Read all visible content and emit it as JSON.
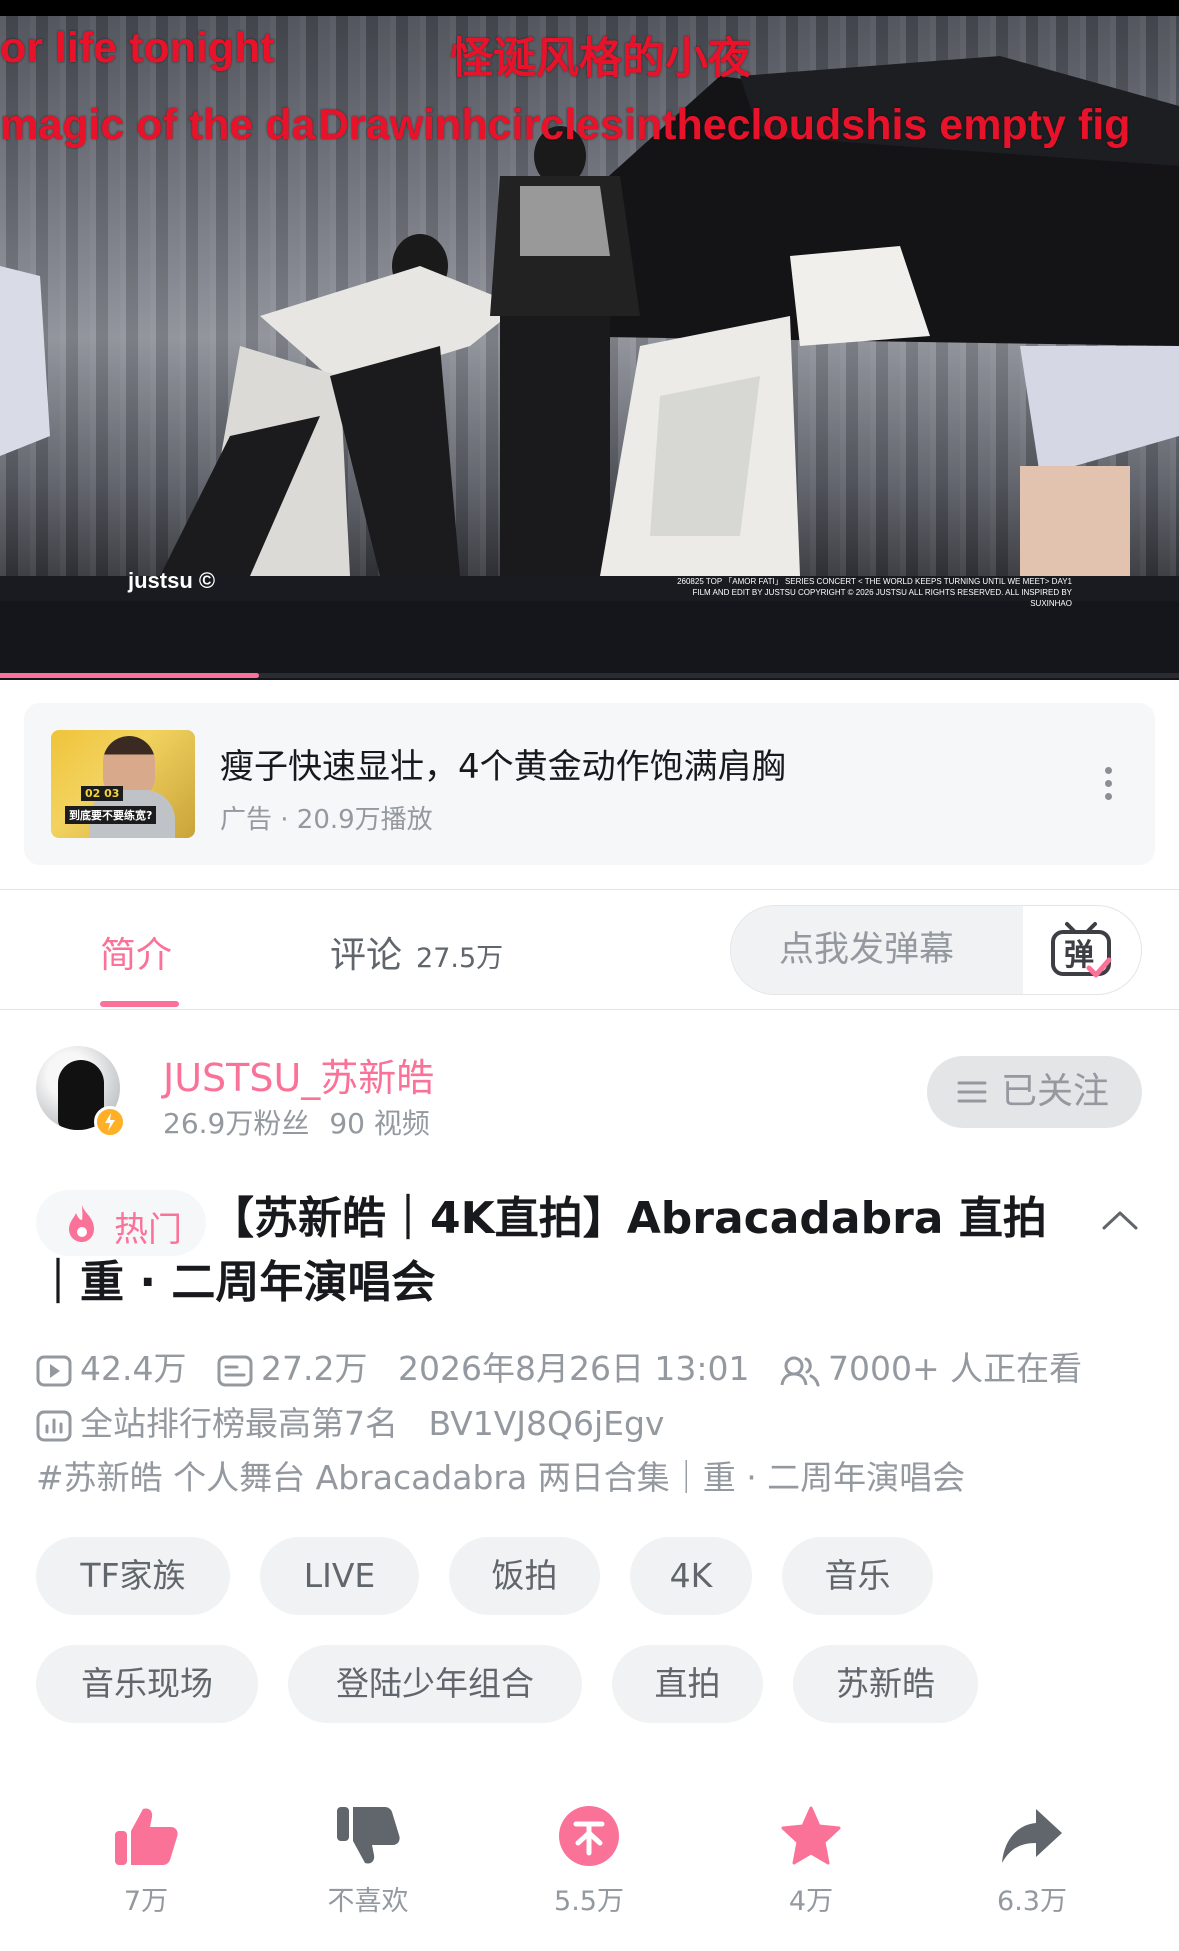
{
  "video": {
    "danmaku": [
      "or life tonight",
      "怪诞风格的小夜",
      "magic of the da",
      "Drawinhcirclesinthecloudshis empty fig"
    ],
    "watermark": "justsu ©",
    "credits": [
      "260825 TOP 「AMOR FATI」 SERIES CONCERT < THE WORLD KEEPS TURNING UNTIL WE MEET> DAY1",
      "FILM AND EDIT BY JUSTSU COPYRIGHT © 2026 JUSTSU ALL RIGHTS RESERVED. ALL INSPIRED BY SUXINHAO"
    ],
    "progress_fraction": 0.22,
    "accent_color": "#fb7299"
  },
  "ad": {
    "thumb_tag1": "02 03",
    "thumb_tag2": "到底要不要练宽?",
    "title": "瘦子快速显壮，4个黄金动作饱满肩胸",
    "subtitle": "广告 · 20.9万播放",
    "more_icon": "more-vertical-icon"
  },
  "tabs": {
    "intro": "简介",
    "comments": "评论",
    "comments_count": "27.5万",
    "danmaku_placeholder": "点我发弹幕",
    "danmaku_toggle_char": "弹"
  },
  "uploader": {
    "name": "JUSTSU_苏新皓",
    "fans": "26.9万粉丝",
    "videos": "90 视频",
    "follow_label": "已关注"
  },
  "video_info": {
    "hot_label": "热门",
    "title": "【苏新皓｜4K直拍】Abracadabra 直拍｜重 · 二周年演唱会",
    "plays": "42.4万",
    "danmaku_count": "27.2万",
    "date": "2026年8月26日 13:01",
    "watching": "7000+ 人正在看",
    "ranking": "全站排行榜最高第7名",
    "bvid": "BV1VJ8Q6jEgv",
    "description": "#苏新皓 个人舞台 Abracadabra 两日合集｜重 · 二周年演唱会"
  },
  "tags": [
    "TF家族",
    "LIVE",
    "饭拍",
    "4K",
    "音乐",
    "音乐现场",
    "登陆少年组合",
    "直拍",
    "苏新皓"
  ],
  "actions": {
    "like": "7万",
    "dislike": "不喜欢",
    "coin": "5.5万",
    "favorite": "4万",
    "share": "6.3万"
  }
}
